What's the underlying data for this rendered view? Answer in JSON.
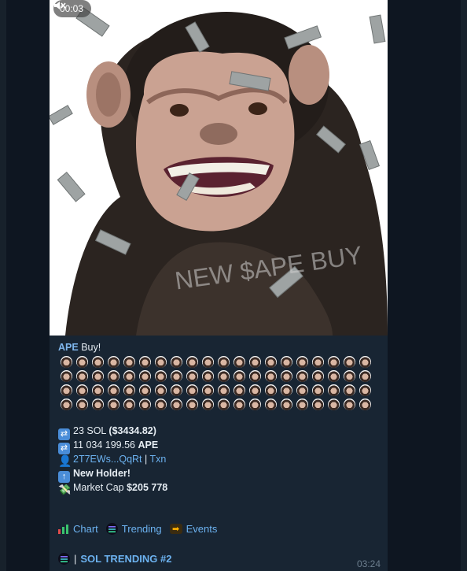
{
  "video": {
    "time": "00:03",
    "mute_icon": "muted-speaker-icon",
    "overlay_text": "NEW $APE BUY"
  },
  "message": {
    "token": "APE",
    "buy_word": "Buy!",
    "emoji_count": 80,
    "sol_amount": "23 SOL",
    "usd_amount": "($3434.82)",
    "token_amount": "11 034 199.56",
    "token_symbol": "APE",
    "wallet": "2T7EWs...QqRt",
    "separator": "|",
    "txn": "Txn",
    "new_holder": "New Holder!",
    "market_cap_label": "Market Cap",
    "market_cap_value": "$205 778"
  },
  "buttons": {
    "chart": "Chart",
    "trending": "Trending",
    "events": "Events"
  },
  "footer": {
    "separator": "|",
    "trending_label": "SOL TRENDING #2",
    "time": "03:24"
  },
  "colors": {
    "bubble": "#182533",
    "link": "#6cb2f0",
    "background": "#0e1621"
  }
}
